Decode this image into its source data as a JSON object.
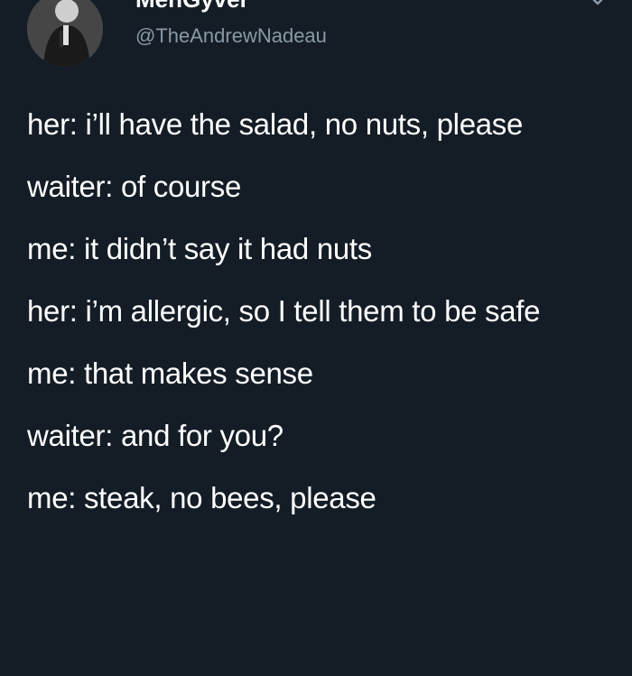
{
  "tweet": {
    "author": {
      "display_name": "MenGyver",
      "handle": "@TheAndrewNadeau",
      "avatar_icon": "profile-photo-avatar"
    },
    "menu_icon": "chevron-down-icon",
    "lines": [
      "her: i’ll have the salad, no nuts, please",
      "waiter: of course",
      "me: it didn’t say it had nuts",
      "her: i’m allergic, so I tell them to be safe",
      "me: that makes sense",
      "waiter: and for you?",
      "me: steak, no bees, please"
    ]
  },
  "colors": {
    "background": "#141d26",
    "text": "#ffffff",
    "secondary_text": "#8a99a6"
  }
}
